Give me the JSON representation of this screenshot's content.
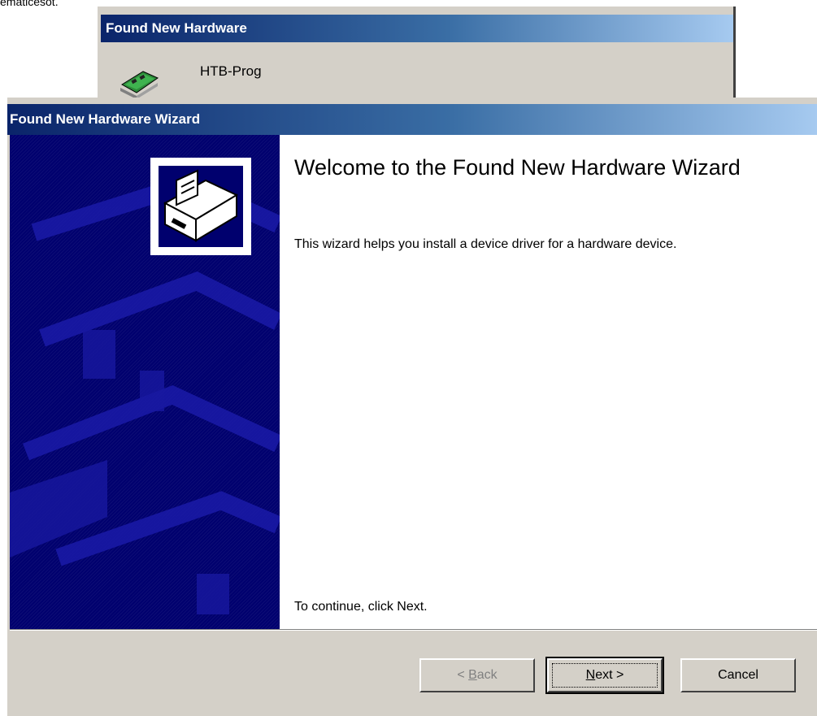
{
  "top_caption": "ematicesot.",
  "background_dialog": {
    "title": "Found New Hardware",
    "device_name": "HTB-Prog"
  },
  "wizard": {
    "title": "Found New Hardware Wizard",
    "heading": "Welcome to the Found New Hardware Wizard",
    "description": "This wizard helps you install a device driver for a hardware device.",
    "continue_text": "To continue, click Next.",
    "buttons": {
      "back": {
        "prefix": "< ",
        "mnemonic": "B",
        "rest": "ack",
        "enabled": false
      },
      "next": {
        "prefix": "",
        "mnemonic": "N",
        "rest": "ext >",
        "enabled": true
      },
      "cancel": "Cancel"
    }
  },
  "colors": {
    "titlebar_start": "#0a246a",
    "titlebar_end": "#a6caf0",
    "banner": "#00006e",
    "dialog_face": "#d4d0c8"
  }
}
